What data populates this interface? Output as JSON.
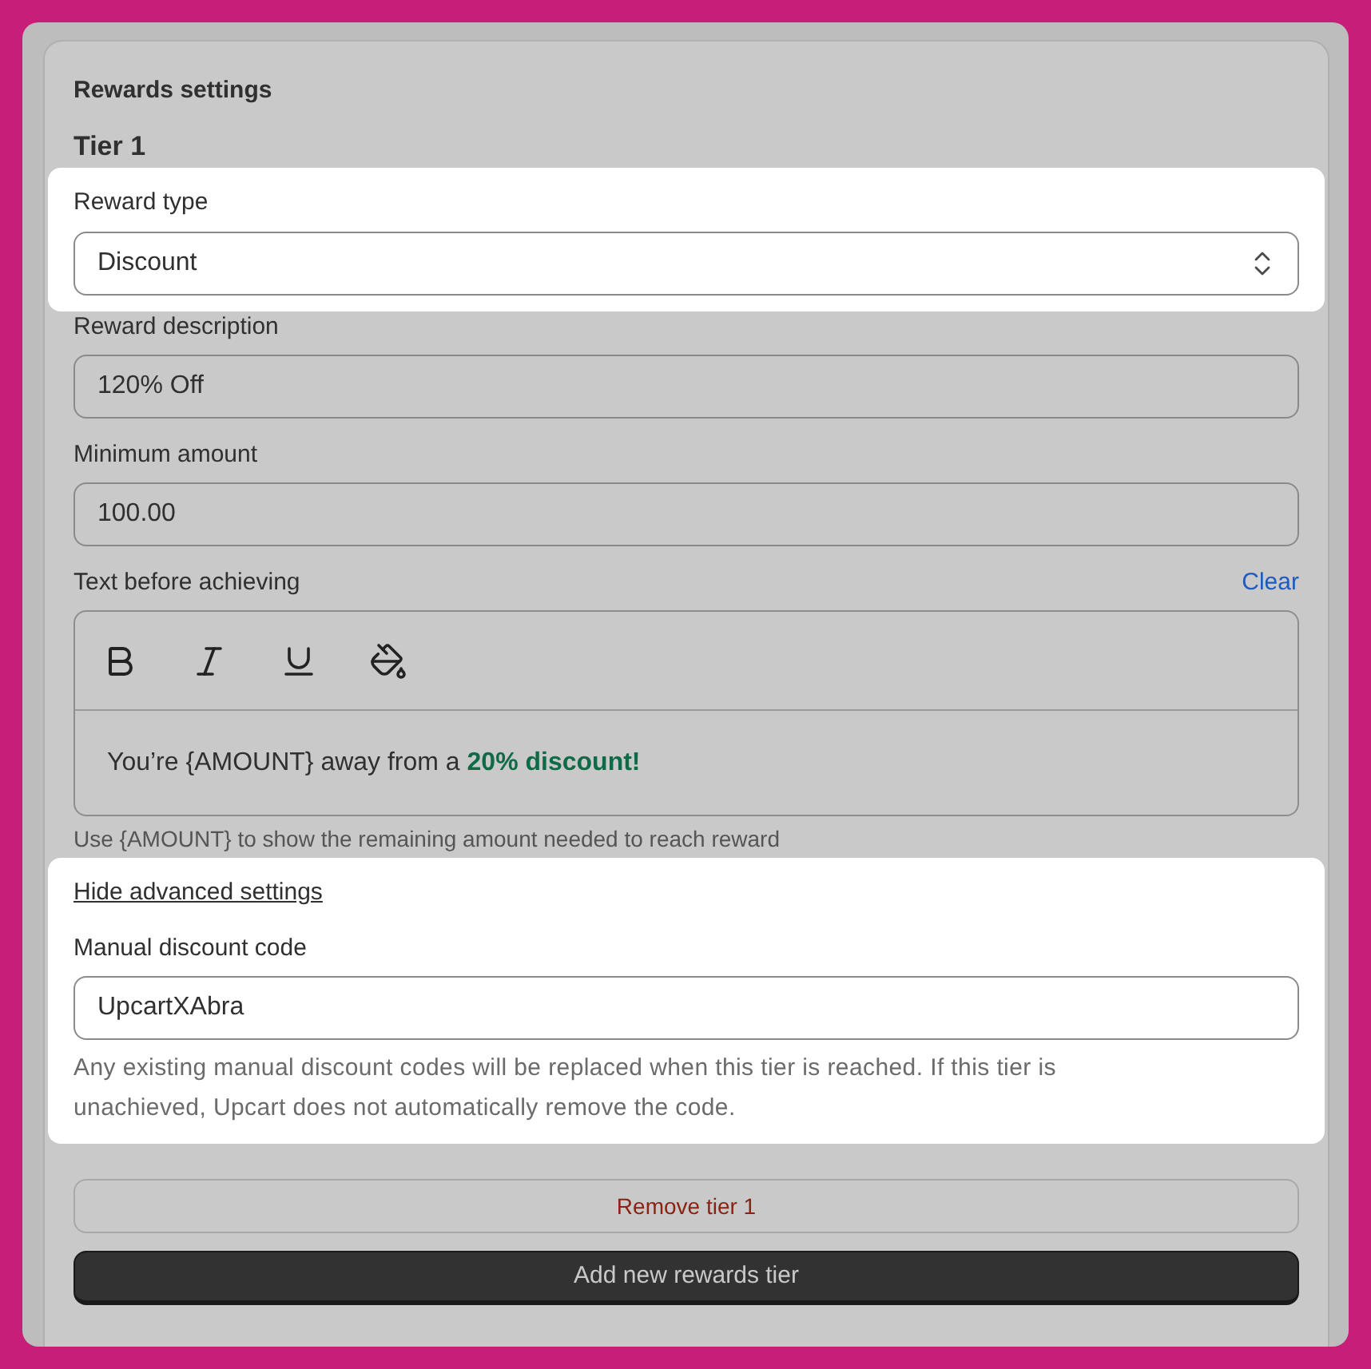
{
  "sections": [
    {
      "highlighted": false,
      "items": [
        {
          "kind": "heading",
          "text": "Rewards settings"
        },
        {
          "kind": "subheading",
          "text": "Tier 1"
        }
      ]
    },
    {
      "highlighted": true,
      "items": [
        {
          "kind": "select",
          "label": "Reward type",
          "value": "Discount"
        }
      ]
    },
    {
      "highlighted": false,
      "items": [
        {
          "kind": "input",
          "label": "Reward description",
          "value": "120% Off"
        },
        {
          "kind": "input",
          "label": "Minimum amount",
          "value": "100.00"
        },
        {
          "kind": "editor",
          "label": "Text before achieving",
          "action": "Clear",
          "content": "You’re {AMOUNT} away from a **20% discount!**",
          "help": "Use {AMOUNT} to show the remaining amount needed to reach reward"
        }
      ]
    },
    {
      "highlighted": true,
      "items": [
        {
          "kind": "link",
          "text": "Hide advanced settings"
        },
        {
          "kind": "input",
          "label": "Manual discount code",
          "value": "UpcartXAbra",
          "help": "Any existing manual discount codes will be replaced when this tier is reached. If this tier is unachieved, Upcart does not automatically remove the code."
        }
      ]
    },
    {
      "highlighted": false,
      "items": [
        {
          "kind": "secondary_button",
          "text": "Remove tier 1"
        },
        {
          "kind": "primary_button",
          "text": "Add new rewards tier"
        }
      ]
    }
  ]
}
